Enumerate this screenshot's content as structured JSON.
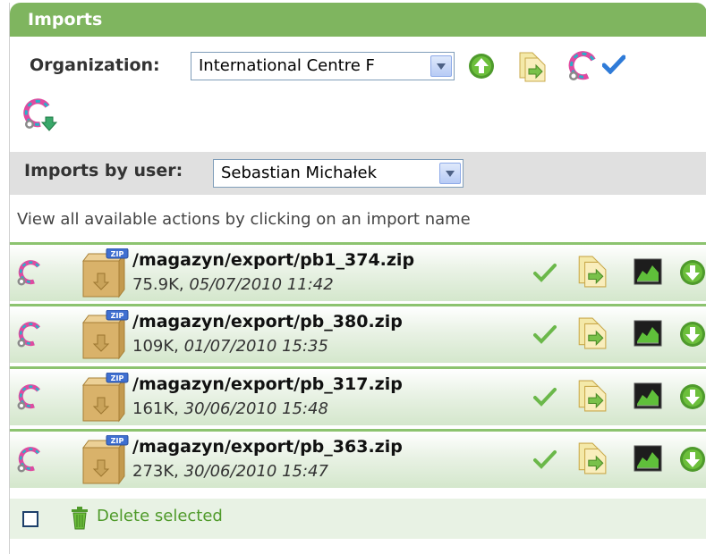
{
  "header": {
    "title": "Imports"
  },
  "organization": {
    "label": "Organization:",
    "selected": "International Centre F"
  },
  "user_filter": {
    "label": "Imports by user:",
    "selected": "Sebastian Michałek"
  },
  "hint": "View all available actions by clicking on an import name",
  "imports": [
    {
      "name": "/magazyn/export/pb1_374.zip",
      "size": "75.9K",
      "date": "05/07/2010 11:42"
    },
    {
      "name": "/magazyn/export/pb_380.zip",
      "size": "109K",
      "date": "01/07/2010 15:35"
    },
    {
      "name": "/magazyn/export/pb_317.zip",
      "size": "161K",
      "date": "30/06/2010 15:48"
    },
    {
      "name": "/magazyn/export/pb_363.zip",
      "size": "273K",
      "date": "30/06/2010 15:47"
    }
  ],
  "file_badge": "ZIP",
  "footer": {
    "delete_label": "Delete selected"
  },
  "colors": {
    "header": "#7fb55f",
    "row_border": "#8cc36f",
    "link_green": "#4f9a2a",
    "check_blue": "#2f7bd8"
  },
  "icons": [
    "upload-icon",
    "import-file-icon",
    "refresh-magnet-icon",
    "checkmark-icon",
    "refresh-download-icon",
    "zip-archive-icon",
    "success-check-icon",
    "chart-icon",
    "download-icon",
    "trash-icon"
  ]
}
